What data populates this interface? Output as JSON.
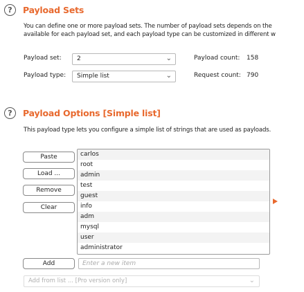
{
  "payload_sets": {
    "title": "Payload Sets",
    "help_icon": "?",
    "description_line1": "You can define one or more payload sets. The number of payload sets depends on the",
    "description_line2": "available for each payload set, and each payload type can be customized in different w",
    "payload_set_label": "Payload set:",
    "payload_set_value": "2",
    "payload_count_label": "Payload count:",
    "payload_count_value": "158",
    "payload_type_label": "Payload type:",
    "payload_type_value": "Simple list",
    "request_count_label": "Request count:",
    "request_count_value": "790"
  },
  "payload_options": {
    "title": "Payload Options [Simple list]",
    "help_icon": "?",
    "description": "This payload type lets you configure a simple list of strings that are used as payloads.",
    "buttons": {
      "paste": "Paste",
      "load": "Load ...",
      "remove": "Remove",
      "clear": "Clear",
      "add": "Add"
    },
    "items": [
      "carlos",
      "root",
      "admin",
      "test",
      "guest",
      "info",
      "adm",
      "mysql",
      "user",
      "administrator"
    ],
    "new_item_placeholder": "Enter a new item",
    "add_from_list": "Add from list ... [Pro version only]"
  },
  "colors": {
    "accent": "#e8692e"
  },
  "icons": {
    "help": "question-circle-icon",
    "dropdown": "chevron-down-icon",
    "selection": "triangle-right-icon"
  }
}
